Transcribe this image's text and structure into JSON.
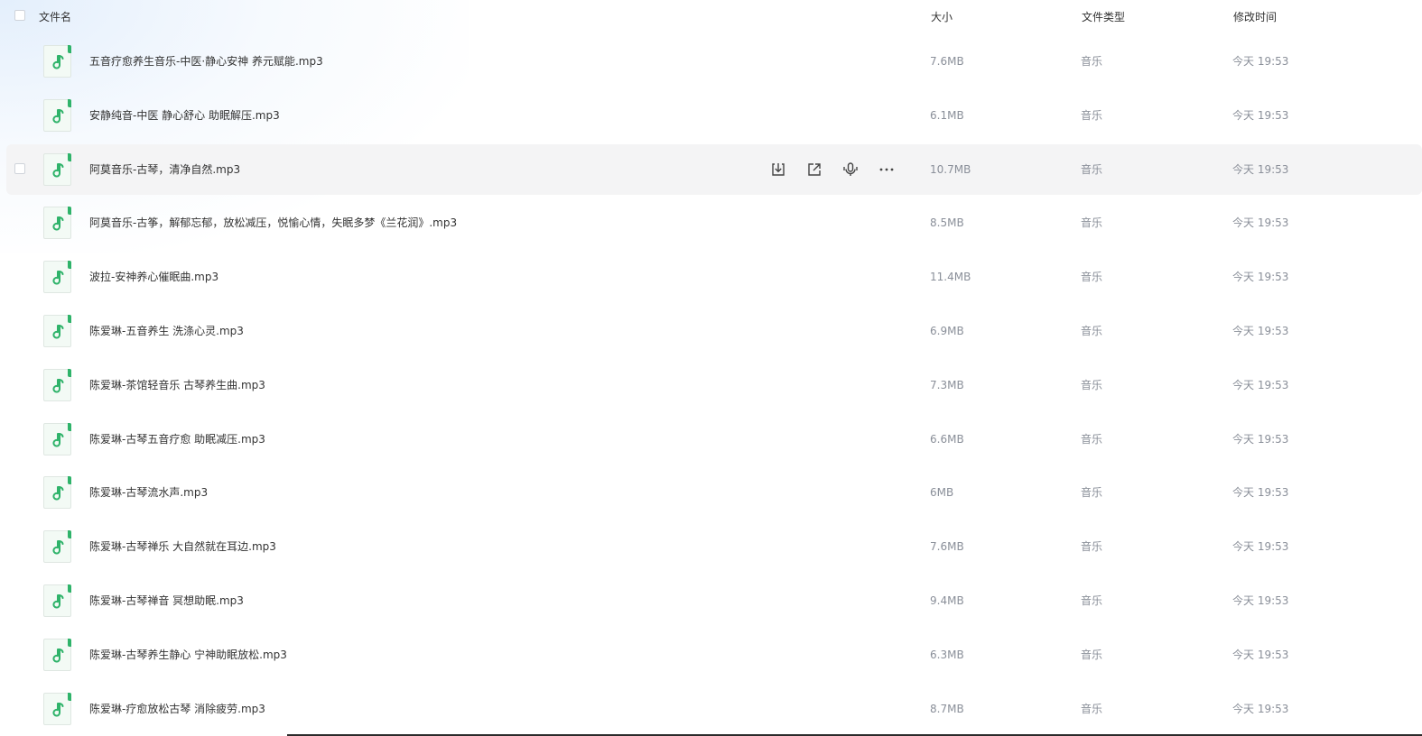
{
  "header": {
    "name_label": "文件名",
    "size_label": "大小",
    "type_label": "文件类型",
    "time_label": "修改时间"
  },
  "colors": {
    "icon_accent": "#2fb36a",
    "hover_row_bg": "#f4f4f5"
  },
  "files": [
    {
      "name": "五音疗愈养生音乐-中医·静心安神 养元赋能.mp3",
      "size": "7.6MB",
      "type": "音乐",
      "time": "今天 19:53",
      "icon": "music-file-icon"
    },
    {
      "name": "安静纯音-中医 静心舒心 助眠解压.mp3",
      "size": "6.1MB",
      "type": "音乐",
      "time": "今天 19:53",
      "icon": "music-file-icon"
    },
    {
      "name": "阿莫音乐-古琴，清净自然.mp3",
      "size": "10.7MB",
      "type": "音乐",
      "time": "今天 19:53",
      "icon": "music-file-icon",
      "hovered": true
    },
    {
      "name": "阿莫音乐-古筝，解郁忘郁，放松减压，悦愉心情，失眠多梦《兰花润》.mp3",
      "size": "8.5MB",
      "type": "音乐",
      "time": "今天 19:53",
      "icon": "music-file-icon"
    },
    {
      "name": "波拉-安神养心催眠曲.mp3",
      "size": "11.4MB",
      "type": "音乐",
      "time": "今天 19:53",
      "icon": "music-file-icon"
    },
    {
      "name": "陈爱琳-五音养生 洗涤心灵.mp3",
      "size": "6.9MB",
      "type": "音乐",
      "time": "今天 19:53",
      "icon": "music-file-icon"
    },
    {
      "name": "陈爱琳-茶馆轻音乐 古琴养生曲.mp3",
      "size": "7.3MB",
      "type": "音乐",
      "time": "今天 19:53",
      "icon": "music-file-icon"
    },
    {
      "name": "陈爱琳-古琴五音疗愈 助眠减压.mp3",
      "size": "6.6MB",
      "type": "音乐",
      "time": "今天 19:53",
      "icon": "music-file-icon"
    },
    {
      "name": "陈爱琳-古琴流水声.mp3",
      "size": "6MB",
      "type": "音乐",
      "time": "今天 19:53",
      "icon": "music-file-icon"
    },
    {
      "name": "陈爱琳-古琴禅乐 大自然就在耳边.mp3",
      "size": "7.6MB",
      "type": "音乐",
      "time": "今天 19:53",
      "icon": "music-file-icon"
    },
    {
      "name": "陈爱琳-古琴禅音 冥想助眠.mp3",
      "size": "9.4MB",
      "type": "音乐",
      "time": "今天 19:53",
      "icon": "music-file-icon"
    },
    {
      "name": "陈爱琳-古琴养生静心 宁神助眠放松.mp3",
      "size": "6.3MB",
      "type": "音乐",
      "time": "今天 19:53",
      "icon": "music-file-icon"
    },
    {
      "name": "陈爱琳-疗愈放松古琴 消除疲劳.mp3",
      "size": "8.7MB",
      "type": "音乐",
      "time": "今天 19:53",
      "icon": "music-file-icon"
    }
  ],
  "hover_actions": [
    {
      "name": "download-icon"
    },
    {
      "name": "share-icon"
    },
    {
      "name": "voice-icon"
    },
    {
      "name": "more-icon"
    }
  ]
}
